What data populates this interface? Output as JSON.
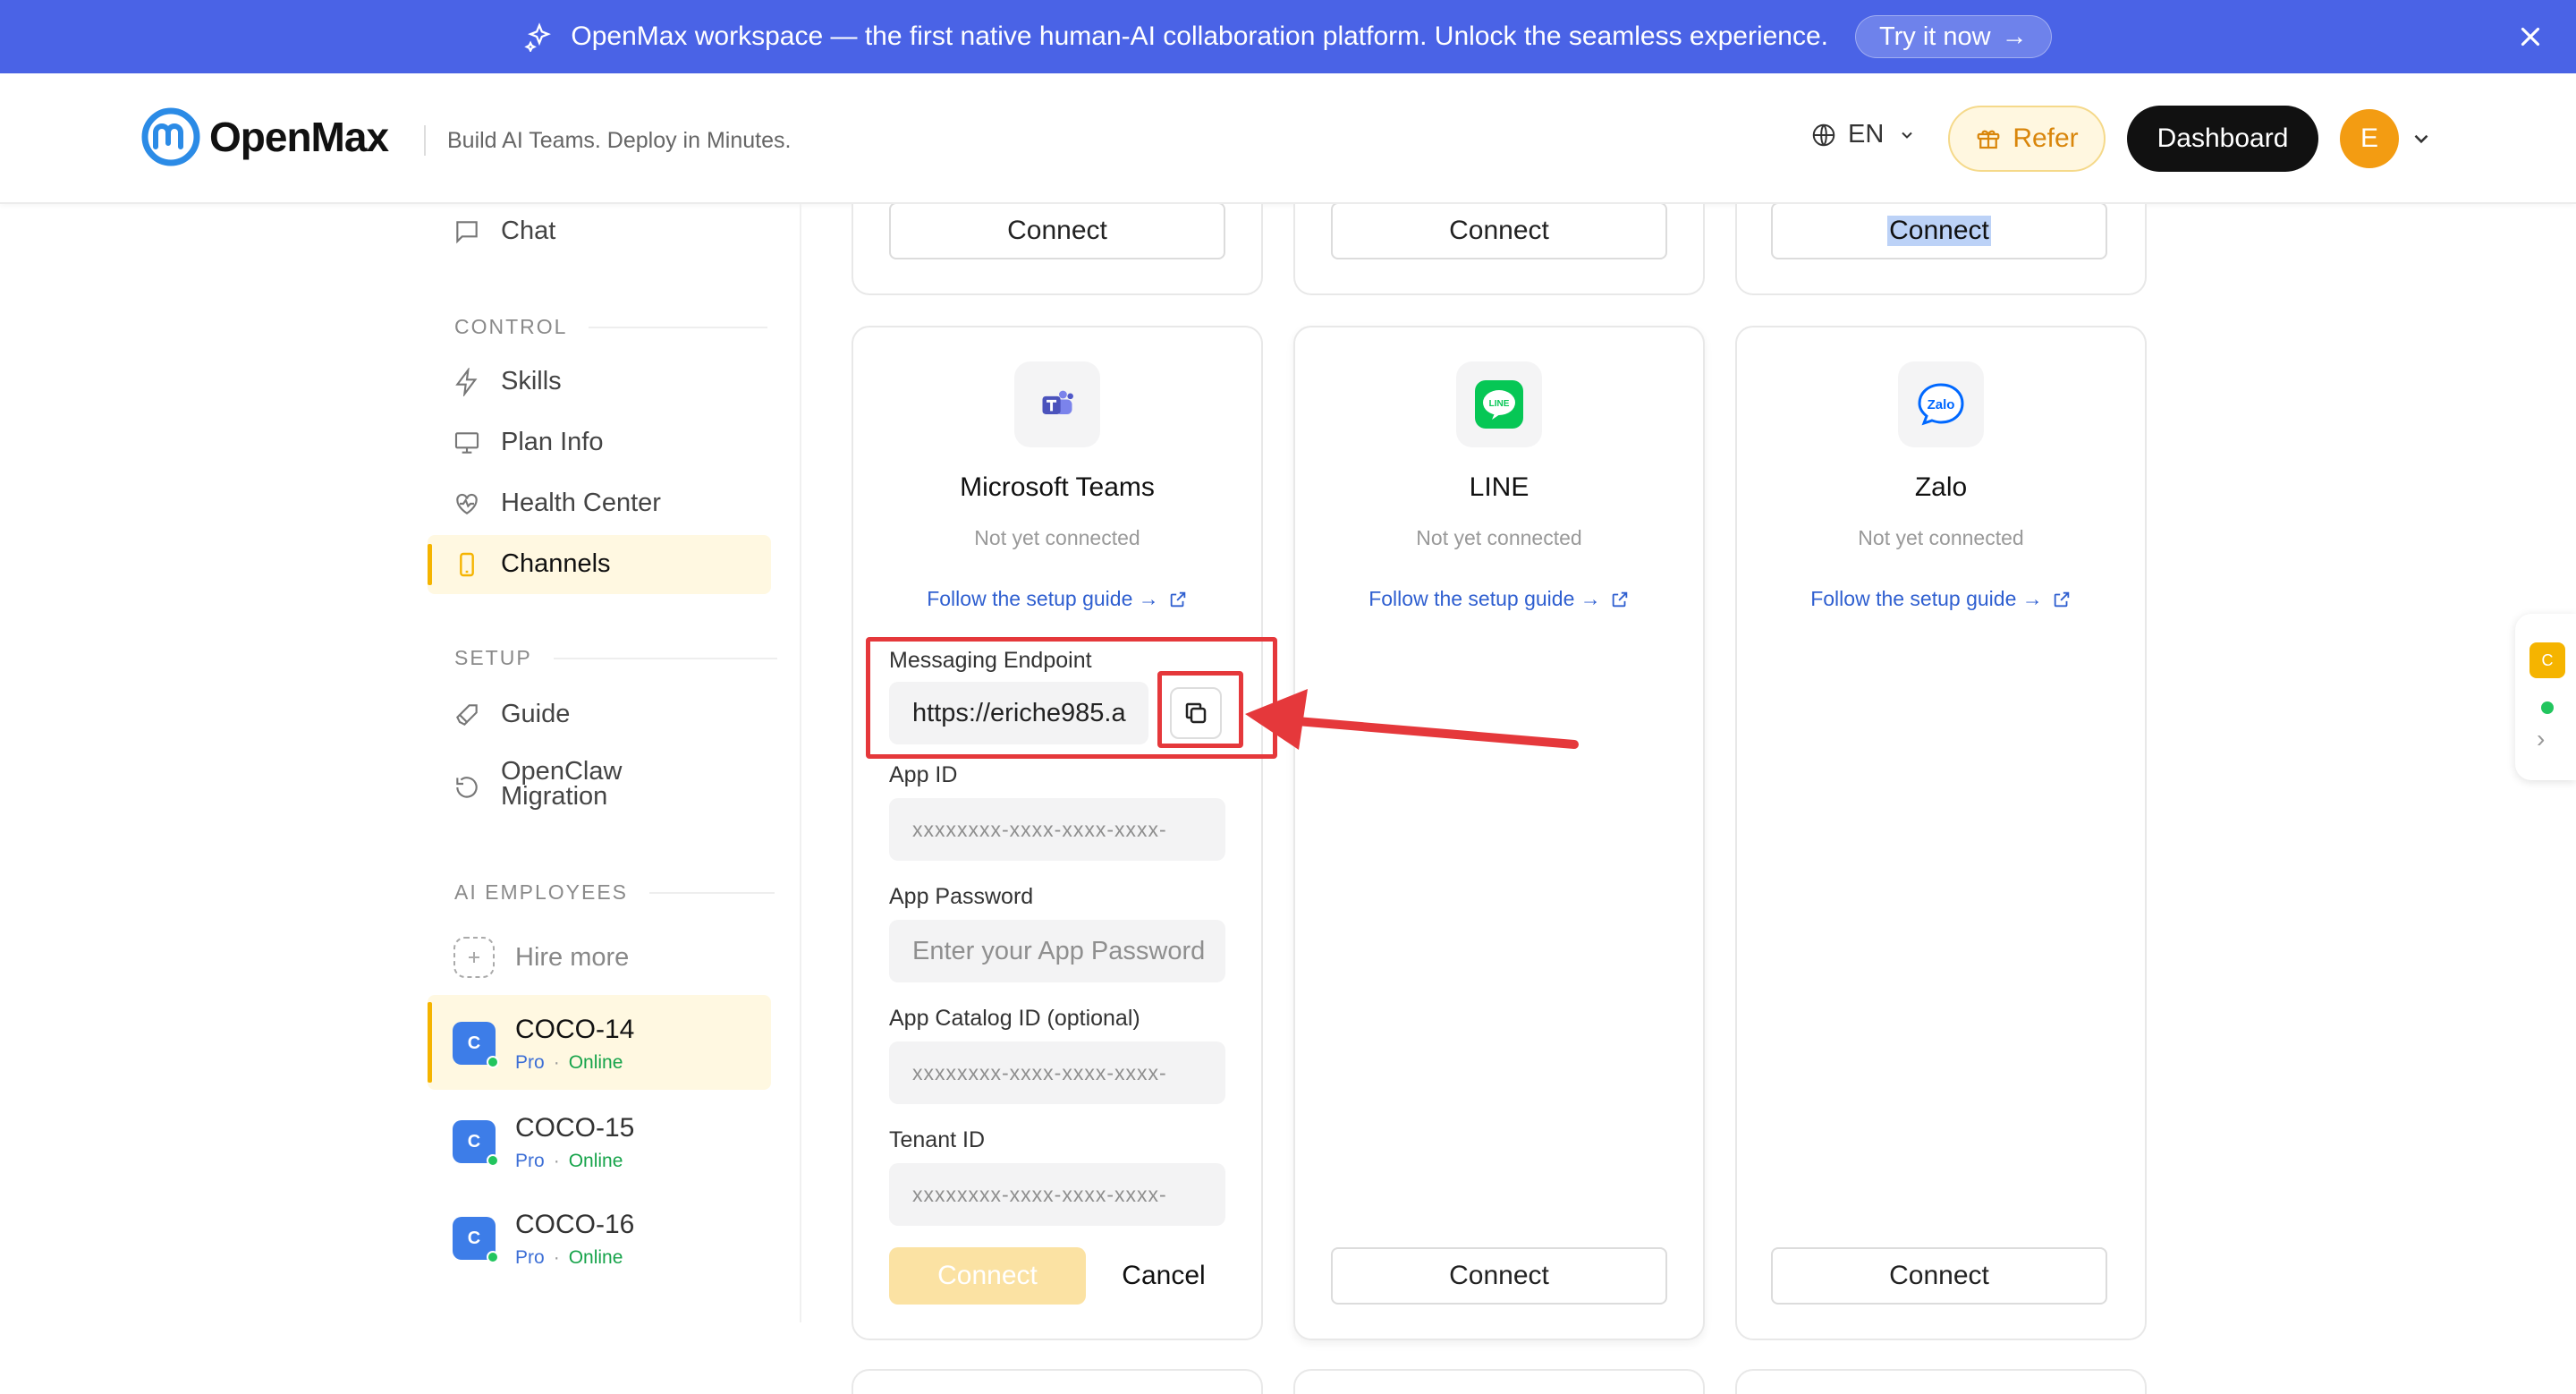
{
  "banner": {
    "text": "OpenMax workspace — the first native human-AI collaboration platform. Unlock the seamless experience.",
    "cta": "Try it now",
    "cta_arrow": "→"
  },
  "header": {
    "brand": "OpenMax",
    "tagline": "Build AI Teams. Deploy in Minutes.",
    "language": "EN",
    "refer_label": "Refer",
    "dashboard_label": "Dashboard",
    "avatar_initial": "E"
  },
  "sidebar": {
    "chat": "Chat",
    "control_label": "CONTROL",
    "control_items": [
      "Skills",
      "Plan Info",
      "Health Center",
      "Channels"
    ],
    "setup_label": "SETUP",
    "guide": "Guide",
    "migration_line1": "OpenClaw",
    "migration_line2": "Migration",
    "employees_label": "AI EMPLOYEES",
    "hire_more": "Hire more",
    "employees": [
      {
        "initial": "C",
        "name": "COCO-14",
        "plan": "Pro",
        "sep": "·",
        "status": "Online"
      },
      {
        "initial": "C",
        "name": "COCO-15",
        "plan": "Pro",
        "sep": "·",
        "status": "Online"
      },
      {
        "initial": "C",
        "name": "COCO-16",
        "plan": "Pro",
        "sep": "·",
        "status": "Online"
      }
    ]
  },
  "top_cards": {
    "connect_label": "Connect"
  },
  "channels": [
    {
      "name": "Microsoft Teams",
      "status": "Not yet connected",
      "guide": "Follow the setup guide →"
    },
    {
      "name": "LINE",
      "status": "Not yet connected",
      "guide": "Follow the setup guide →",
      "icon_text": "LINE"
    },
    {
      "name": "Zalo",
      "status": "Not yet connected",
      "guide": "Follow the setup guide →",
      "icon_text": "Zalo"
    }
  ],
  "teams_form": {
    "endpoint_label": "Messaging Endpoint",
    "endpoint_value": "https://eriche985.a",
    "app_id_label": "App ID",
    "app_id_placeholder": "xxxxxxxx-xxxx-xxxx-xxxx-",
    "app_password_label": "App Password",
    "app_password_placeholder": "Enter your App Password",
    "catalog_label": "App Catalog ID (optional)",
    "catalog_placeholder": "xxxxxxxx-xxxx-xxxx-xxxx-",
    "tenant_label": "Tenant ID",
    "tenant_placeholder": "xxxxxxxx-xxxx-xxxx-xxxx-",
    "connect_label": "Connect",
    "cancel_label": "Cancel"
  },
  "right_widget": {
    "initial": "C",
    "arrow": "›"
  },
  "colors": {
    "banner": "#4a63e6",
    "accent_yellow": "#f5b400",
    "annotation_red": "#e5383b",
    "link_blue": "#2f5fd0",
    "online_green": "#16a34a"
  }
}
